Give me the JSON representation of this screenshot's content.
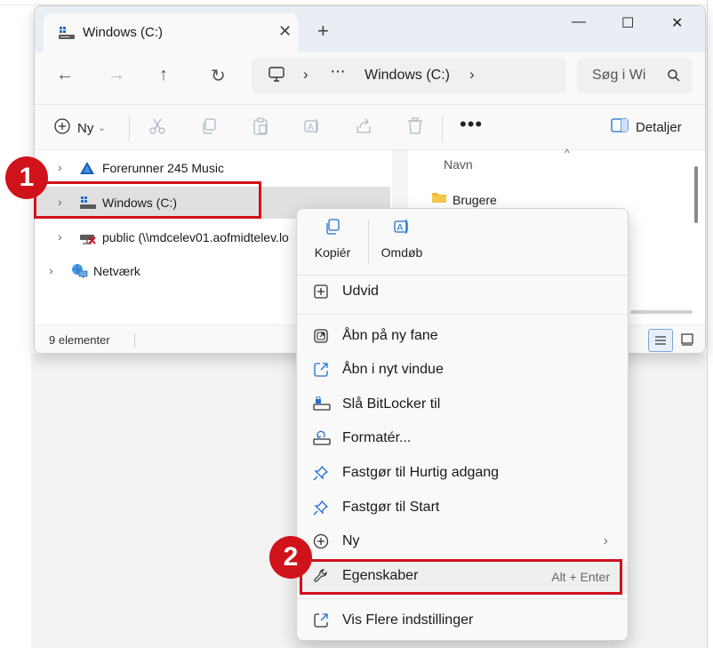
{
  "window": {
    "tab_title": "Windows (C:)",
    "tab_close": "✕",
    "new_tab": "+",
    "minimize": "—",
    "maximize": "☐",
    "close": "✕"
  },
  "navbar": {
    "back": "←",
    "forward": "→",
    "up": "↑",
    "refresh": "↻",
    "address_chevron": "›",
    "address_dots": "···",
    "address_location": "Windows (C:)",
    "address_chevron_end": "›",
    "search_placeholder": "Søg i Wi"
  },
  "toolbar": {
    "new_label": "Ny",
    "new_chevron": "⌄",
    "more": "•••",
    "details_label": "Detaljer"
  },
  "nav_tree": [
    {
      "label": "Forerunner 245 Music",
      "icon": "garmin-triangle-icon"
    },
    {
      "label": "Windows (C:)",
      "icon": "drive-icon"
    },
    {
      "label": "public (\\\\mdcelev01.aofmidtelev.lo",
      "icon": "network-drive-icon"
    },
    {
      "label": "Netværk",
      "icon": "network-icon"
    }
  ],
  "file_pane": {
    "column_header": "Navn",
    "sort_arrow": "^",
    "items": [
      {
        "name": "Brugere",
        "icon": "folder-icon"
      }
    ]
  },
  "status": {
    "count_text": "9 elementer"
  },
  "annotations": {
    "step1": "1",
    "step2": "2",
    "color": "#d0121b"
  },
  "context_menu": {
    "top_buttons": [
      {
        "label": "Kopiér",
        "icon": "copy-icon"
      },
      {
        "label": "Omdøb",
        "icon": "rename-icon"
      }
    ],
    "items": [
      {
        "label": "Udvid",
        "icon": "expand-icon"
      },
      {
        "label": "Åbn på ny fane",
        "icon": "open-new-tab-icon"
      },
      {
        "label": "Åbn i nyt vindue",
        "icon": "open-new-window-icon"
      },
      {
        "label": "Slå BitLocker til",
        "icon": "bitlocker-icon"
      },
      {
        "label": "Formatér...",
        "icon": "format-icon"
      },
      {
        "label": "Fastgør til Hurtig adgang",
        "icon": "pin-icon"
      },
      {
        "label": "Fastgør til Start",
        "icon": "pin-icon"
      },
      {
        "label": "Ny",
        "icon": "new-icon",
        "submenu": "›"
      },
      {
        "label": "Egenskaber",
        "icon": "wrench-icon",
        "shortcut": "Alt + Enter"
      },
      {
        "label": "Vis Flere indstillinger",
        "icon": "more-options-icon"
      }
    ]
  }
}
